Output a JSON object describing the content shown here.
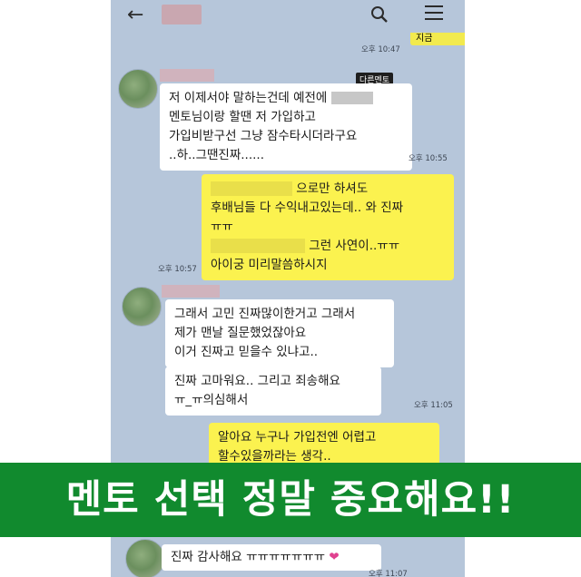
{
  "header": {
    "back_icon": "arrow-left-icon",
    "search_icon": "search-icon",
    "menu_icon": "hamburger-menu-icon"
  },
  "messages": {
    "top_time": "오후 10:47",
    "top_partial": "지금",
    "m1": {
      "tag": "다른멘토",
      "line1": "저 이제서야 말하는건데 예전에",
      "line2": "멘토님이랑 할땐 저 가입하고",
      "line3": "가입비받구선 그냥 잠수타시더라구요",
      "line4": "..하..그땐진짜......",
      "time": "오후 10:55"
    },
    "m2": {
      "line1_suffix": "으로만 하셔도",
      "line2": "후배님들 다 수익내고있는데.. 와 진짜",
      "line3": "ㅠㅠ",
      "line4_suffix": "그런 사연이..ㅠㅠ",
      "line5": "아이궁 미리말씀하시지",
      "time": "오후 10:57"
    },
    "m3": {
      "line1": "그래서 고민 진짜많이한거고 그래서",
      "line2": "제가 맨날 질문했었잖아요",
      "line3": "이거 진짜고 믿을수 있냐고.."
    },
    "m4": {
      "line1": "진짜 고마워요.. 그리고 죄송해요",
      "line2": "ㅠ_ㅠ의심해서",
      "time": "오후 11:05"
    },
    "m5": {
      "line1": "알아요 누구나 가입전엔 어렵고",
      "line2": "할수있을까라는 생각.."
    },
    "m6": {
      "line1": "진짜 감사해요 ㅠㅠㅠㅠㅠㅠㅠ",
      "time": "오후 11:07"
    }
  },
  "banner": {
    "text": "멘토 선택 정말 중요해요!!"
  },
  "colors": {
    "chat_bg": "#b6c6da",
    "my_bubble": "#fbf24f",
    "banner": "#118a2e"
  }
}
